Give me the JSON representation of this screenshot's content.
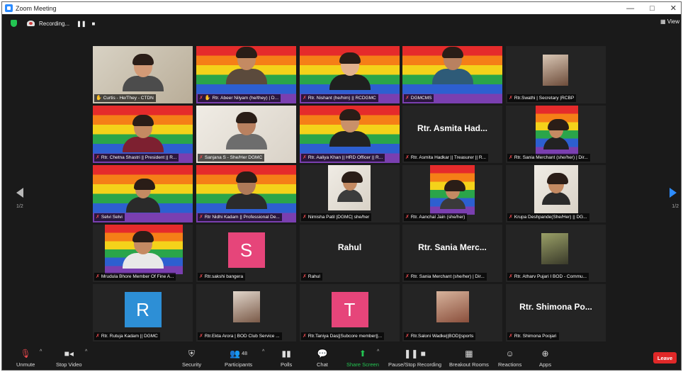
{
  "window": {
    "title": "Zoom Meeting",
    "controls": [
      "—",
      "□",
      "✕"
    ]
  },
  "topbar": {
    "recording_label": "Recording...",
    "pause_glyph": "❚❚",
    "stop_glyph": "■",
    "view_label": "View"
  },
  "pager": {
    "left": "1/2",
    "right": "1/2"
  },
  "tiles": [
    {
      "name": "Curtis - He/They - CTDN",
      "muted": false,
      "hand": true
    },
    {
      "name": "Rtr. Abeer Nilyam (he/they) | D...",
      "muted": true,
      "hand": true
    },
    {
      "name": "Rtr. Nishant (he/him) || RCDGMC",
      "muted": true,
      "hand": false
    },
    {
      "name": "DGMCMS",
      "muted": true,
      "hand": false
    },
    {
      "name": "Rtr.Swathi | Secretary |RCBP",
      "muted": true,
      "hand": false
    },
    {
      "name": "Rtr. Chetna Shastri || President || R...",
      "muted": true,
      "hand": false
    },
    {
      "name": "Sanjana S - She/Her DGMC",
      "muted": true,
      "hand": false
    },
    {
      "name": "Rtr. Aaliya Khan || HRD Officer || R...",
      "muted": true,
      "hand": false
    },
    {
      "name": "Rtr. Asmita Hadkar || Treasurer || R...",
      "muted": true,
      "hand": false,
      "display_name": "Rtr. Asmita Had..."
    },
    {
      "name": "Rtr. Sania Merchant (she/her) | Dir...",
      "muted": true,
      "hand": false
    },
    {
      "name": "Selvi Selvi",
      "muted": true,
      "hand": false
    },
    {
      "name": "Rtr Nidhi Kadam || Professional De...",
      "muted": true,
      "hand": false
    },
    {
      "name": "Nimisha Patil |DGMC| she/her",
      "muted": true,
      "hand": false
    },
    {
      "name": "Rtr. Aanchal Jain (she/her)",
      "muted": true,
      "hand": false
    },
    {
      "name": "Krupa Deshpande(She/Her) || DG...",
      "muted": true,
      "hand": false
    },
    {
      "name": "Mrudula Bhore Member Of Fine A...",
      "muted": true,
      "hand": false
    },
    {
      "name": "Rtr.sakshi bangera",
      "muted": true,
      "hand": false,
      "initial": "S",
      "color": "#e6457a"
    },
    {
      "name": "Rahul",
      "muted": true,
      "hand": false,
      "display_name": "Rahul"
    },
    {
      "name": "Rtr. Sania Merchant (she/her) | Dir...",
      "muted": true,
      "hand": false,
      "display_name": "Rtr. Sania Merc..."
    },
    {
      "name": "Rtr. Atharv Pujari I BOD - Commu...",
      "muted": true,
      "hand": false
    },
    {
      "name": "Rtr. Rutuja Kadam || DGMC",
      "muted": true,
      "hand": false,
      "initial": "R",
      "color": "#2d8fd6"
    },
    {
      "name": "Rtr.Ekta Arora | BOD Club Service ...",
      "muted": true,
      "hand": false
    },
    {
      "name": "Rtr.Taniya Das||Subcore member||...",
      "muted": true,
      "hand": false,
      "initial": "T",
      "color": "#e6457a"
    },
    {
      "name": "Rtr.Saloni Wadke||BOD||sports",
      "muted": true,
      "hand": false
    },
    {
      "name": "Rtr. Shimona Poojari",
      "muted": true,
      "hand": false,
      "display_name": "Rtr. Shimona Po..."
    }
  ],
  "toolbar": {
    "unmute": "Unmute",
    "stop_video": "Stop Video",
    "security": "Security",
    "participants": "Participants",
    "participants_count": "48",
    "polls": "Polls",
    "chat": "Chat",
    "share_screen": "Share Screen",
    "pause_recording": "Pause/Stop Recording",
    "breakout": "Breakout Rooms",
    "reactions": "Reactions",
    "apps": "Apps",
    "leave": "Leave"
  },
  "colors": {
    "accent": "#2d8cff",
    "share_green": "#23c552",
    "leave_red": "#e02828",
    "muted_red": "#e5484d"
  }
}
